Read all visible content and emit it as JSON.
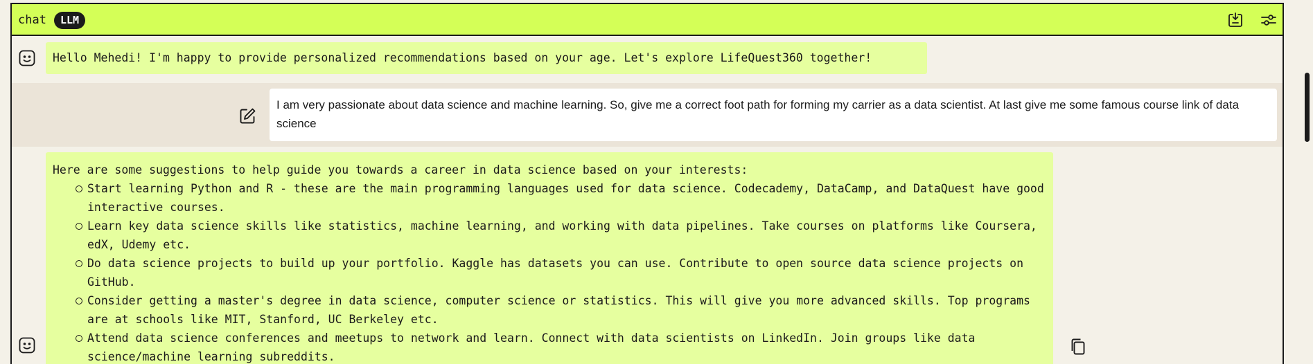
{
  "header": {
    "title": "chat",
    "badge": "LLM",
    "icons": [
      "export-icon",
      "settings-sliders-icon"
    ]
  },
  "messages": {
    "greeting": "Hello Mehedi! I'm happy to provide personalized recommendations based on your age. Let's explore LifeQuest360 together!",
    "user": "I am very passionate about data science and machine learning. So, give me a correct foot path for forming my carrier as a data scientist. At last give me some famous course link of data science",
    "response": {
      "intro": "Here are some suggestions to help guide you towards a career in data science based on your interests:",
      "items": [
        "Start learning Python and R - these are the main programming languages used for data science. Codecademy, DataCamp, and DataQuest have good interactive courses.",
        "Learn key data science skills like statistics, machine learning, and working with data pipelines. Take courses on platforms like Coursera, edX, Udemy etc.",
        "Do data science projects to build up your portfolio. Kaggle has datasets you can use. Contribute to open source data science projects on GitHub.",
        "Consider getting a master's degree in data science, computer science or statistics. This will give you more advanced skills. Top programs are at schools like MIT, Stanford, UC Berkeley etc.",
        "Attend data science conferences and meetups to network and learn. Connect with data scientists on LinkedIn. Join groups like data science/machine learning subreddits."
      ]
    }
  },
  "colors": {
    "header_bg": "#d4ff57",
    "bot_bubble_bg": "#e6ff9f",
    "user_row_bg": "#ebe4d8",
    "page_bg": "#f4f1e8",
    "ink": "#1b1b1b"
  }
}
